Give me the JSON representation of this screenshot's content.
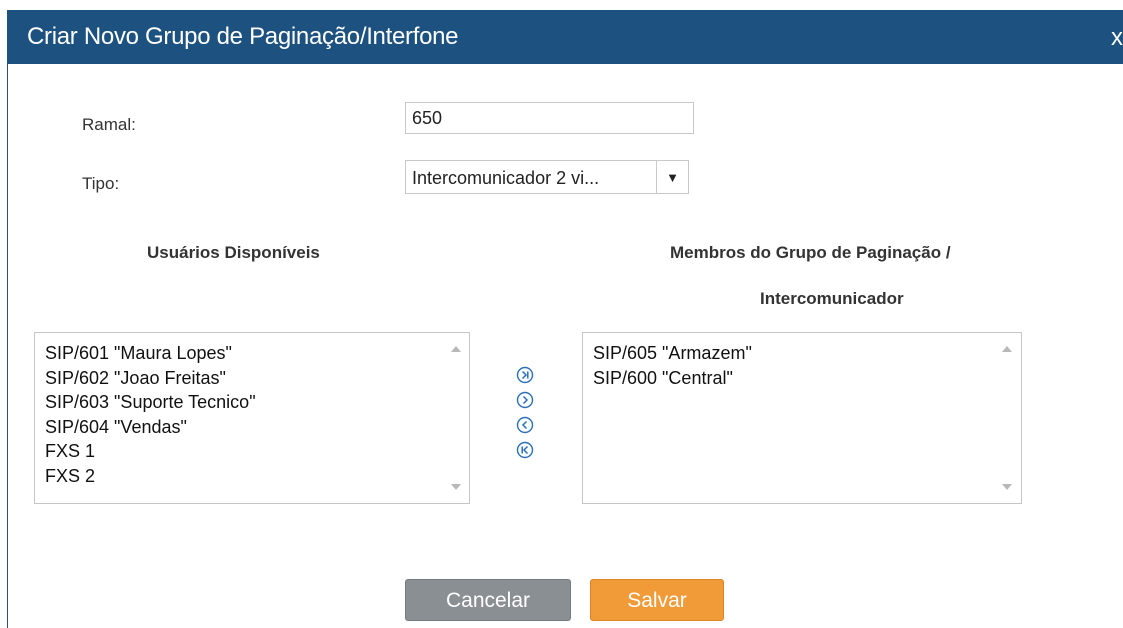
{
  "dialog": {
    "title": "Criar Novo Grupo de Paginação/Interfone",
    "close_label": "x"
  },
  "form": {
    "extension_label": "Ramal:",
    "extension_value": "650",
    "type_label": "Tipo:",
    "type_value": "Intercomunicador 2 vi...",
    "type_arrow": "▼"
  },
  "available": {
    "heading": "Usuários Disponíveis",
    "items": [
      "SIP/601 \"Maura Lopes\"",
      "SIP/602 \"Joao Freitas\"",
      "SIP/603 \"Suporte Tecnico\"",
      "SIP/604 \"Vendas\"",
      "FXS 1",
      "FXS 2"
    ]
  },
  "members": {
    "heading_line1": "Membros do Grupo de Paginação /",
    "heading_line2": "Intercomunicador",
    "items": [
      "SIP/605 \"Armazem\"",
      "SIP/600 \"Central\""
    ]
  },
  "transfer_buttons": [
    {
      "icon": "move-all-right-icon"
    },
    {
      "icon": "move-right-icon"
    },
    {
      "icon": "move-left-icon"
    },
    {
      "icon": "move-all-left-icon"
    }
  ],
  "footer": {
    "cancel_label": "Cancelar",
    "save_label": "Salvar"
  },
  "colors": {
    "titlebar": "#1c5180",
    "cancel_button": "#8a8f93",
    "save_button": "#f19a38",
    "icon_blue": "#2a6fb8"
  }
}
